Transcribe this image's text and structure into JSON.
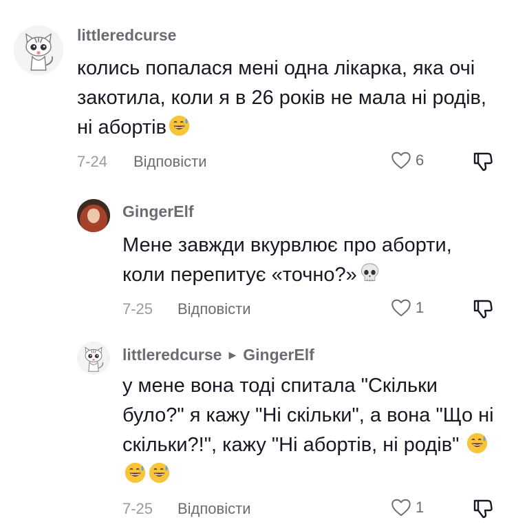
{
  "comments": [
    {
      "username": "littleredcurse",
      "text": "колись попалася мені одна лікарка, яка очі закотила, коли я в 26 років не мала ні родів, ні абортів",
      "emoji": "sweat-smile",
      "date": "7-24",
      "reply_label": "Відповісти",
      "likes": "6",
      "avatar": "cat-avatar"
    },
    {
      "username": "GingerElf",
      "text": "Мене завжди вкурвлює про аборти, коли перепитує «точно?»",
      "emoji": "skull",
      "date": "7-25",
      "reply_label": "Відповісти",
      "likes": "1",
      "avatar": "red-hair-avatar"
    },
    {
      "username": "littleredcurse",
      "reply_to": "GingerElf",
      "text": "у мене вона тоді спитала \"Скільки було?\" я кажу \"Ні скільки\", а вона \"Що ні скільки?!\", кажу \"Ні абортів, ні родів\"",
      "emoji": "sweat-smile x3",
      "date": "7-25",
      "reply_label": "Відповісти",
      "likes": "1",
      "avatar": "cat-avatar"
    }
  ]
}
